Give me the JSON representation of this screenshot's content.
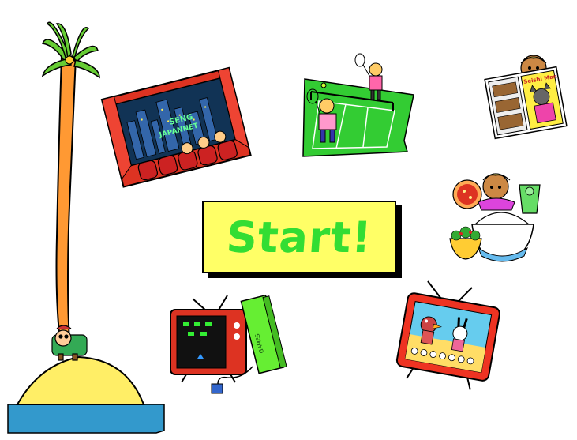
{
  "start_button": {
    "label": "Start!"
  },
  "movie_sign": {
    "line1": "SENG",
    "line2": "JAPANNET"
  },
  "magazine": {
    "cover_title": "Seishi Man"
  },
  "game_cart": {
    "label": "GAMES"
  },
  "icons": {
    "island": "palm-island-icon",
    "movie": "movie-theater-icon",
    "tennis": "tennis-icon",
    "magazine": "manga-magazine-icon",
    "food": "food-icon",
    "videogame": "video-game-tv-icon",
    "anime": "anime-tv-icon"
  },
  "colors": {
    "button_bg": "#ffff66",
    "button_text": "#33dd33",
    "sea": "#3399cc",
    "sand": "#ffee66"
  }
}
